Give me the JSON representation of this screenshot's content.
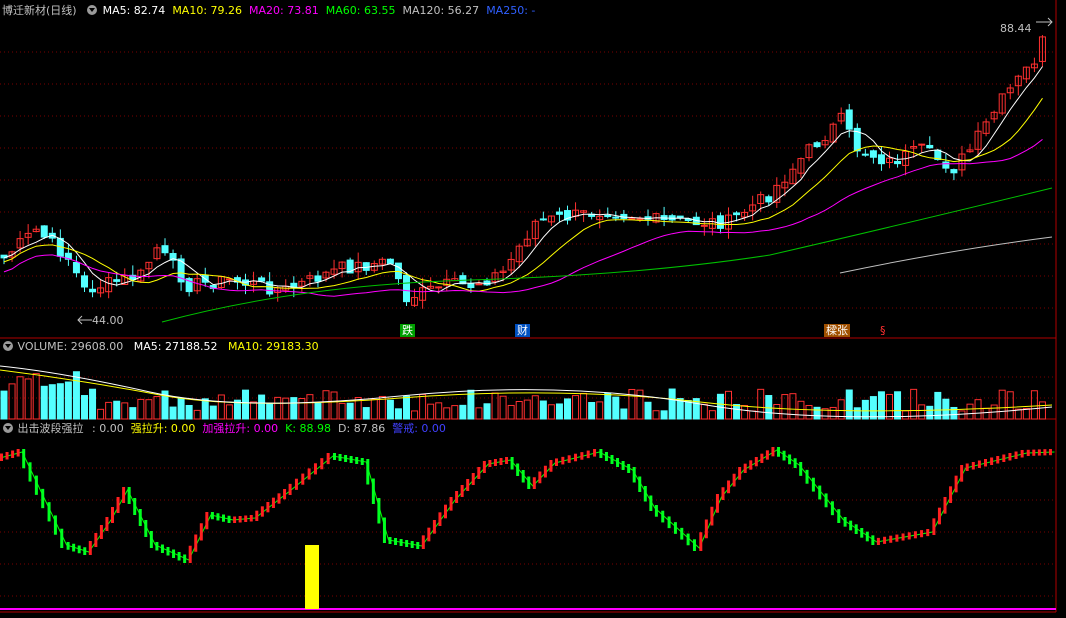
{
  "main": {
    "title": "博迁新材(日线)",
    "ma": [
      {
        "label": "MA5: 82.74",
        "color": "#ffffff"
      },
      {
        "label": "MA10: 79.26",
        "color": "#ffff00"
      },
      {
        "label": "MA20: 73.81",
        "color": "#ff00ff"
      },
      {
        "label": "MA60: 63.55",
        "color": "#00ff00"
      },
      {
        "label": "MA120: 56.27",
        "color": "#c0c0c0"
      },
      {
        "label": "MA250: -",
        "color": "#3060ff"
      }
    ],
    "high_label": "88.44",
    "low_label": "44.00",
    "badges": [
      {
        "text": "跌",
        "color": "#ffffff",
        "bg": "#00a000"
      },
      {
        "text": "财",
        "color": "#ffffff",
        "bg": "#0050c0"
      },
      {
        "text": "樑张",
        "color": "#ffffff",
        "bg": "#a05000"
      },
      {
        "text": "§",
        "color": "#ff3030",
        "bg": "transparent"
      }
    ]
  },
  "volume": {
    "label": "VOLUME: 29608.00",
    "ma5": "MA5: 27188.52",
    "ma10": "MA10: 29183.30"
  },
  "indicator": {
    "title": "出击波段强拉",
    "items": [
      {
        "label": ": 0.00",
        "color": "#c0c0c0"
      },
      {
        "label": "强拉升: 0.00",
        "color": "#ffff00"
      },
      {
        "label": "加强拉升: 0.00",
        "color": "#ff00ff"
      },
      {
        "label": "K: 88.98",
        "color": "#00ff00"
      },
      {
        "label": "D: 87.86",
        "color": "#c0c0c0"
      },
      {
        "label": "警戒: 0.00",
        "color": "#4040ff"
      }
    ]
  },
  "colors": {
    "up": "#ff3030",
    "down": "#54ffff",
    "grid": "#7a0000",
    "border": "#b00000"
  },
  "chart_data": {
    "type": "candlestick",
    "title": "博迁新材(日线)",
    "price_range": [
      44.0,
      88.44
    ],
    "highest_marked": 88.44,
    "lowest_marked": 44.0,
    "ma_last": {
      "MA5": 82.74,
      "MA10": 79.26,
      "MA20": 73.81,
      "MA60": 63.55,
      "MA120": 56.27
    },
    "volume_last": 29608.0,
    "indicator_last": {
      "K": 88.98,
      "D": 87.86
    }
  }
}
